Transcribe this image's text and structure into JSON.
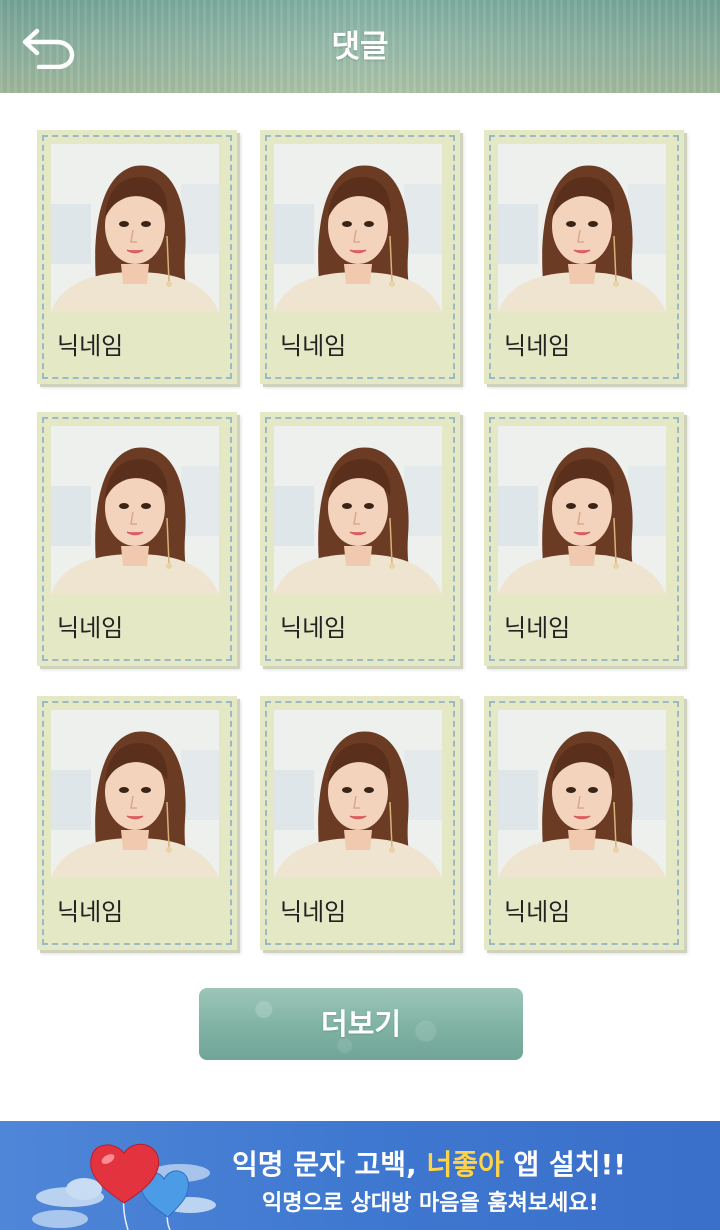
{
  "header": {
    "title": "댓글",
    "back_icon": "back-arrow-icon"
  },
  "grid": {
    "items": [
      {
        "nickname": "닉네임"
      },
      {
        "nickname": "닉네임"
      },
      {
        "nickname": "닉네임"
      },
      {
        "nickname": "닉네임"
      },
      {
        "nickname": "닉네임"
      },
      {
        "nickname": "닉네임"
      },
      {
        "nickname": "닉네임"
      },
      {
        "nickname": "닉네임"
      },
      {
        "nickname": "닉네임"
      }
    ]
  },
  "more_button": {
    "label": "더보기"
  },
  "banner": {
    "line1_prefix": "익명 문자 고백,",
    "line1_brand": "너좋아",
    "line1_suffix": "앱 설치!!",
    "line2": "익명으로 상대방 마음을 훔쳐보세요!"
  },
  "colors": {
    "header": "#8fb7a6",
    "card": "#e5e8c4",
    "card_border": "#9bbac5",
    "button": "#7fb2a3",
    "banner": "#4077d0",
    "banner_accent": "#ffd44a"
  }
}
